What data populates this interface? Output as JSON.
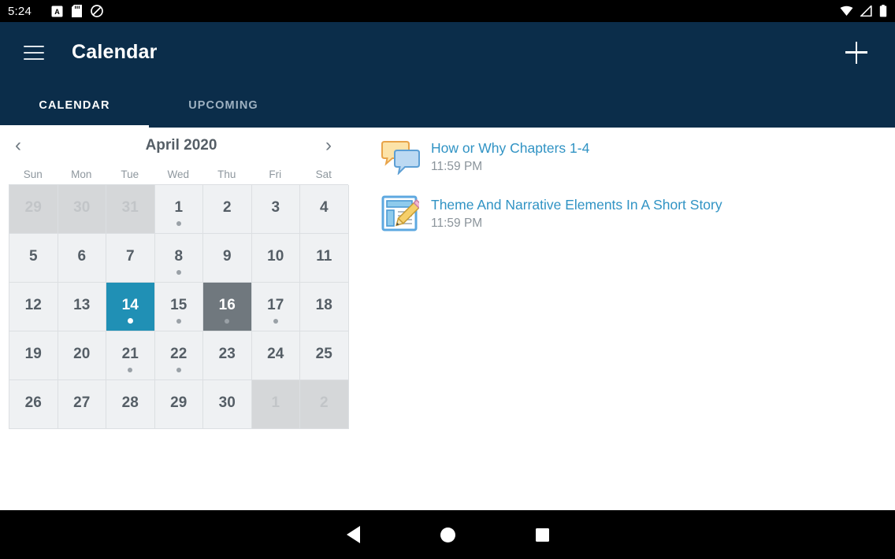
{
  "status_bar": {
    "time": "5:24",
    "left_icons": [
      "a-badge-icon",
      "sd-card-icon",
      "do-not-disturb-icon"
    ],
    "right_icons": [
      "wifi-icon",
      "cellular-signal-icon",
      "battery-icon"
    ]
  },
  "app_bar": {
    "menu_icon": "hamburger-menu-icon",
    "title": "Calendar",
    "add_icon": "plus-icon"
  },
  "tabs": [
    {
      "label": "CALENDAR",
      "selected": true
    },
    {
      "label": "UPCOMING",
      "selected": false
    }
  ],
  "calendar": {
    "title": "April 2020",
    "prev_label": "‹",
    "next_label": "›",
    "weekdays": [
      "Sun",
      "Mon",
      "Tue",
      "Wed",
      "Thu",
      "Fri",
      "Sat"
    ],
    "colors": {
      "selected": "#2090b5",
      "today": "#70787e",
      "cell": "#eff1f3",
      "other_month_cell": "#d5d7d9",
      "dot": "#9aa1a7"
    },
    "weeks": [
      [
        {
          "day": "29",
          "other": true
        },
        {
          "day": "30",
          "other": true
        },
        {
          "day": "31",
          "other": true
        },
        {
          "day": "1",
          "dot": true
        },
        {
          "day": "2"
        },
        {
          "day": "3"
        },
        {
          "day": "4"
        }
      ],
      [
        {
          "day": "5"
        },
        {
          "day": "6"
        },
        {
          "day": "7"
        },
        {
          "day": "8",
          "dot": true
        },
        {
          "day": "9"
        },
        {
          "day": "10"
        },
        {
          "day": "11"
        }
      ],
      [
        {
          "day": "12"
        },
        {
          "day": "13"
        },
        {
          "day": "14",
          "selected": true,
          "dot": true
        },
        {
          "day": "15",
          "dot": true
        },
        {
          "day": "16",
          "today": true,
          "dot": true
        },
        {
          "day": "17",
          "dot": true
        },
        {
          "day": "18"
        }
      ],
      [
        {
          "day": "19"
        },
        {
          "day": "20"
        },
        {
          "day": "21",
          "dot": true
        },
        {
          "day": "22",
          "dot": true
        },
        {
          "day": "23"
        },
        {
          "day": "24"
        },
        {
          "day": "25"
        }
      ],
      [
        {
          "day": "26"
        },
        {
          "day": "27"
        },
        {
          "day": "28"
        },
        {
          "day": "29"
        },
        {
          "day": "30"
        },
        {
          "day": "1",
          "other": true
        },
        {
          "day": "2",
          "other": true
        }
      ]
    ]
  },
  "events": [
    {
      "icon": "forum-discussion-icon",
      "title": "How or Why Chapters 1-4",
      "time": "11:59 PM"
    },
    {
      "icon": "assignment-page-pencil-icon",
      "title": "Theme And Narrative Elements In A Short Story",
      "time": "11:59 PM"
    }
  ],
  "nav_bar": {
    "back": "back-triangle-icon",
    "home": "home-circle-icon",
    "recents": "recents-square-icon"
  }
}
